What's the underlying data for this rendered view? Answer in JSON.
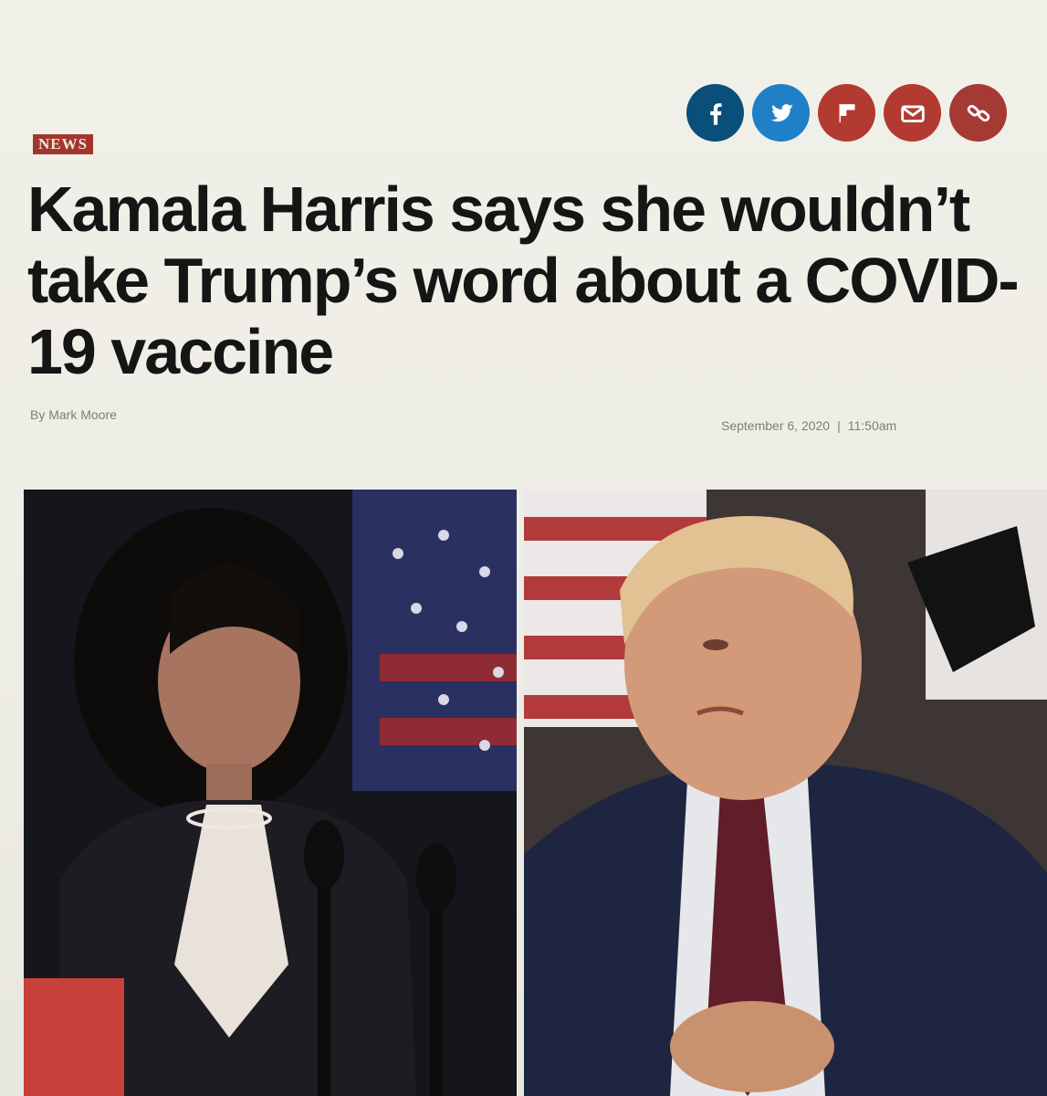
{
  "share": {
    "buttons": [
      {
        "icon": "facebook-icon",
        "color": "#0a4f7a"
      },
      {
        "icon": "twitter-icon",
        "color": "#1f80c8"
      },
      {
        "icon": "flipboard-icon",
        "color": "#b23a30"
      },
      {
        "icon": "email-icon",
        "color": "#b23a30"
      },
      {
        "icon": "link-icon",
        "color": "#a53a35"
      }
    ]
  },
  "article": {
    "section": "NEWS",
    "headline": "Kamala Harris says she wouldn’t take Trump’s word about a COVID-19 vaccine",
    "byline": "By Mark Moore",
    "date": "September 6, 2020",
    "separator": "|",
    "time": "11:50am"
  },
  "colors": {
    "accent": "#a3362c",
    "headline": "#151515",
    "background": "#efeee6"
  }
}
